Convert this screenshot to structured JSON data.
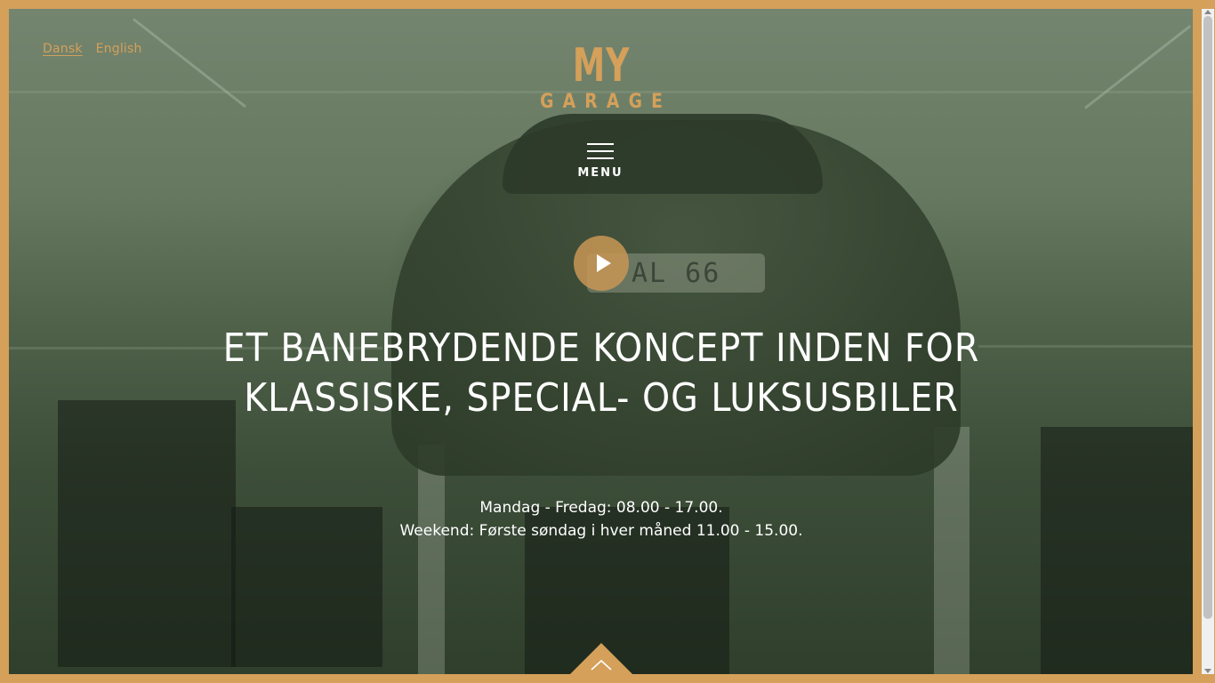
{
  "colors": {
    "accent": "#d4a05a",
    "overlay": "#3b4a3b",
    "text": "#ffffff"
  },
  "language": {
    "items": [
      {
        "label": "Dansk",
        "active": true
      },
      {
        "label": "English",
        "active": false
      }
    ]
  },
  "logo": {
    "top": "MY",
    "bottom": "GARAGE"
  },
  "menu": {
    "label": "MENU",
    "icon": "hamburger-icon"
  },
  "video": {
    "icon": "play-icon"
  },
  "hero": {
    "line1": "ET BANEBRYDENDE KONCEPT INDEN FOR",
    "line2": "KLASSISKE, SPECIAL- OG LUKSUSBILER"
  },
  "hours": {
    "weekdays": "Mandag - Fredag: 08.00 - 17.00.",
    "weekend": "Weekend: Første søndag i hver måned 11.00 - 15.00."
  },
  "scroll": {
    "icon": "chevron-up-icon"
  },
  "background_plate_text": "AL 66"
}
